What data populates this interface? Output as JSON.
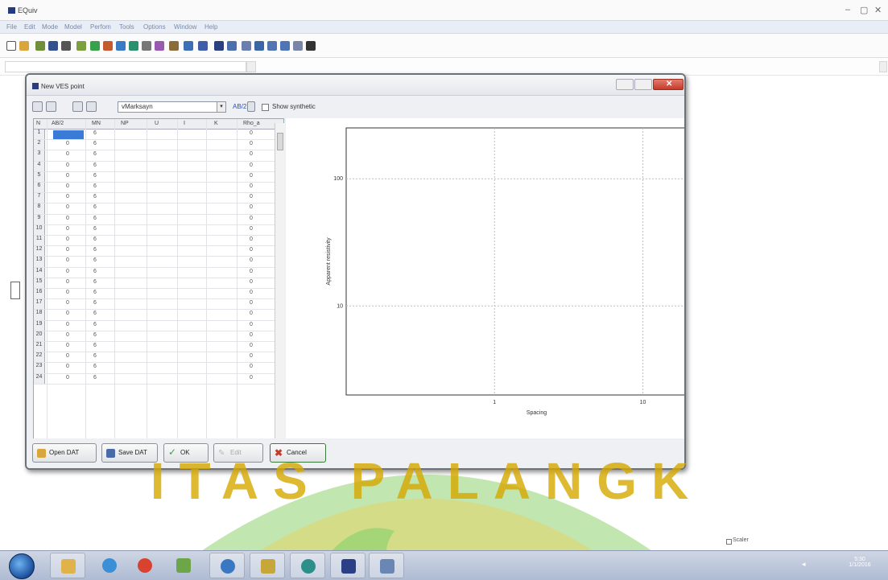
{
  "app": {
    "title": "EQuiv",
    "window_controls": [
      "–",
      "▢",
      "✕"
    ]
  },
  "menu": [
    "File",
    "Edit",
    "Mode",
    "Model",
    "Perfom",
    "Tools",
    "Options",
    "Window",
    "Help"
  ],
  "dialog": {
    "title": "New VES point",
    "title_buttons": [
      "",
      ""
    ],
    "combo_value": "vMarksayn",
    "combo_arrow": "▾",
    "ab_label": "AB/2",
    "show_synthetic_label": "Show synthetic",
    "grid": {
      "headers": [
        "N",
        "AB/2",
        "MN",
        "NP",
        "U",
        "I",
        "K",
        "Rho_a"
      ],
      "rows": [
        {
          "n": "1",
          "ab": "0",
          "mn": "6",
          "rho": "0"
        },
        {
          "n": "2",
          "ab": "0",
          "mn": "6",
          "rho": "0"
        },
        {
          "n": "3",
          "ab": "0",
          "mn": "6",
          "rho": "0"
        },
        {
          "n": "4",
          "ab": "0",
          "mn": "6",
          "rho": "0"
        },
        {
          "n": "5",
          "ab": "0",
          "mn": "6",
          "rho": "0"
        },
        {
          "n": "6",
          "ab": "0",
          "mn": "6",
          "rho": "0"
        },
        {
          "n": "7",
          "ab": "0",
          "mn": "6",
          "rho": "0"
        },
        {
          "n": "8",
          "ab": "0",
          "mn": "6",
          "rho": "0"
        },
        {
          "n": "9",
          "ab": "0",
          "mn": "6",
          "rho": "0"
        },
        {
          "n": "10",
          "ab": "0",
          "mn": "6",
          "rho": "0"
        },
        {
          "n": "11",
          "ab": "0",
          "mn": "6",
          "rho": "0"
        },
        {
          "n": "12",
          "ab": "0",
          "mn": "6",
          "rho": "0"
        },
        {
          "n": "13",
          "ab": "0",
          "mn": "6",
          "rho": "0"
        },
        {
          "n": "14",
          "ab": "0",
          "mn": "6",
          "rho": "0"
        },
        {
          "n": "15",
          "ab": "0",
          "mn": "6",
          "rho": "0"
        },
        {
          "n": "16",
          "ab": "0",
          "mn": "6",
          "rho": "0"
        },
        {
          "n": "17",
          "ab": "0",
          "mn": "6",
          "rho": "0"
        },
        {
          "n": "18",
          "ab": "0",
          "mn": "6",
          "rho": "0"
        },
        {
          "n": "19",
          "ab": "0",
          "mn": "6",
          "rho": "0"
        },
        {
          "n": "20",
          "ab": "0",
          "mn": "6",
          "rho": "0"
        },
        {
          "n": "21",
          "ab": "0",
          "mn": "6",
          "rho": "0"
        },
        {
          "n": "22",
          "ab": "0",
          "mn": "6",
          "rho": "0"
        },
        {
          "n": "23",
          "ab": "0",
          "mn": "6",
          "rho": "0"
        },
        {
          "n": "24",
          "ab": "0",
          "mn": "6",
          "rho": "0"
        }
      ]
    },
    "buttons": {
      "open": "Open DAT",
      "save": "Save DAT",
      "ok": "OK",
      "edit": "Edit",
      "cancel": "Cancel"
    }
  },
  "chart_data": {
    "type": "scatter",
    "xlabel": "Spacing",
    "ylabel": "Apparent resistivity",
    "x_ticks": [
      "1",
      "10"
    ],
    "y_ticks": [
      "100",
      "10"
    ],
    "grid": true,
    "series": []
  },
  "status": {
    "scaler_label": "Scaler"
  },
  "taskbar": {
    "clock_time": "5:30",
    "clock_date": "1/1/2016"
  },
  "watermark": {
    "text": "ITAS PALANGK"
  },
  "colors": {
    "accent": "#1f3b8a",
    "close_red": "#c43b2a",
    "watermark_green": "#5fbf3f",
    "watermark_gold": "#d8b000"
  }
}
